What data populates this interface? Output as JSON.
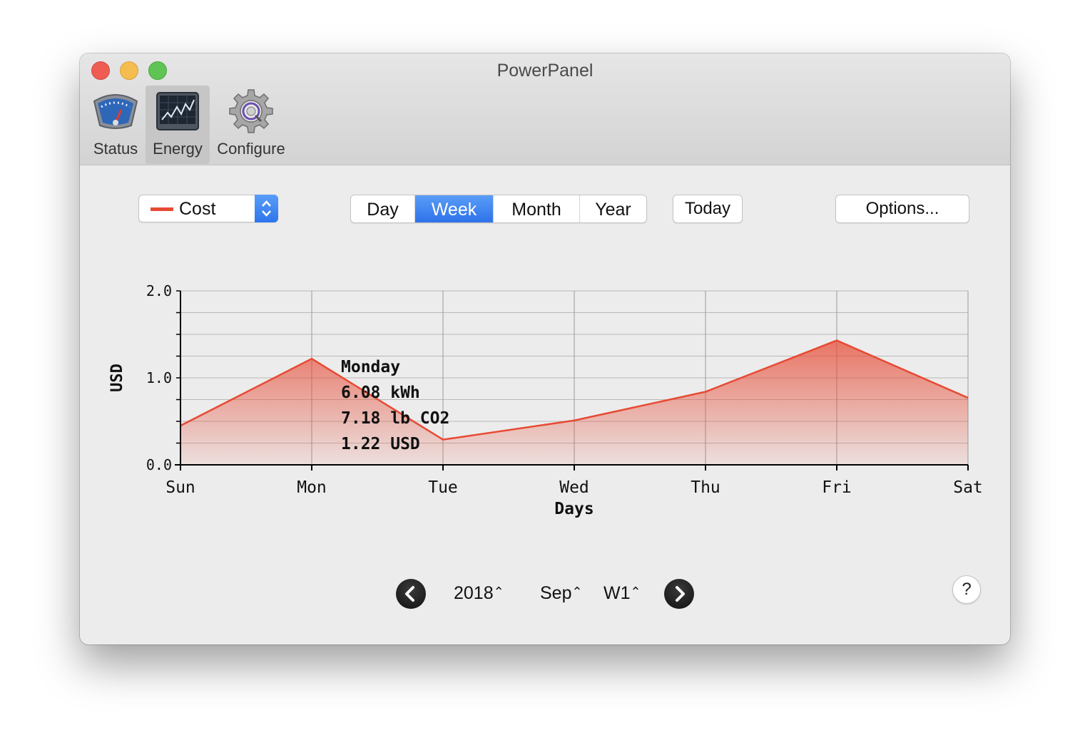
{
  "window": {
    "title": "PowerPanel"
  },
  "toolbar": {
    "items": [
      {
        "label": "Status",
        "icon": "gauge-icon",
        "selected": false
      },
      {
        "label": "Energy",
        "icon": "energy-chart-icon",
        "selected": true
      },
      {
        "label": "Configure",
        "icon": "gear-icon",
        "selected": false
      }
    ]
  },
  "controls": {
    "metric_select": {
      "value": "Cost",
      "swatch_color": "#e74a34"
    },
    "period_segments": [
      "Day",
      "Week",
      "Month",
      "Year"
    ],
    "period_selected": "Week",
    "today_label": "Today",
    "options_label": "Options..."
  },
  "chart_data": {
    "type": "area",
    "xlabel": "Days",
    "ylabel": "USD",
    "categories": [
      "Sun",
      "Mon",
      "Tue",
      "Wed",
      "Thu",
      "Fri",
      "Sat"
    ],
    "series": [
      {
        "values": [
          0.45,
          1.22,
          0.29,
          0.51,
          0.84,
          1.43,
          0.77
        ],
        "color": "#e74a34"
      }
    ],
    "ylim": [
      0.0,
      2.0
    ],
    "yticks": [
      "0.0",
      "1.0",
      "2.0"
    ],
    "grid": true,
    "tooltip": {
      "lines": [
        "Monday",
        "6.08 kWh",
        "7.18 lb CO2",
        "1.22 USD"
      ]
    }
  },
  "footer": {
    "year": "2018",
    "month": "Sep",
    "week": "W1",
    "help_label": "?"
  }
}
